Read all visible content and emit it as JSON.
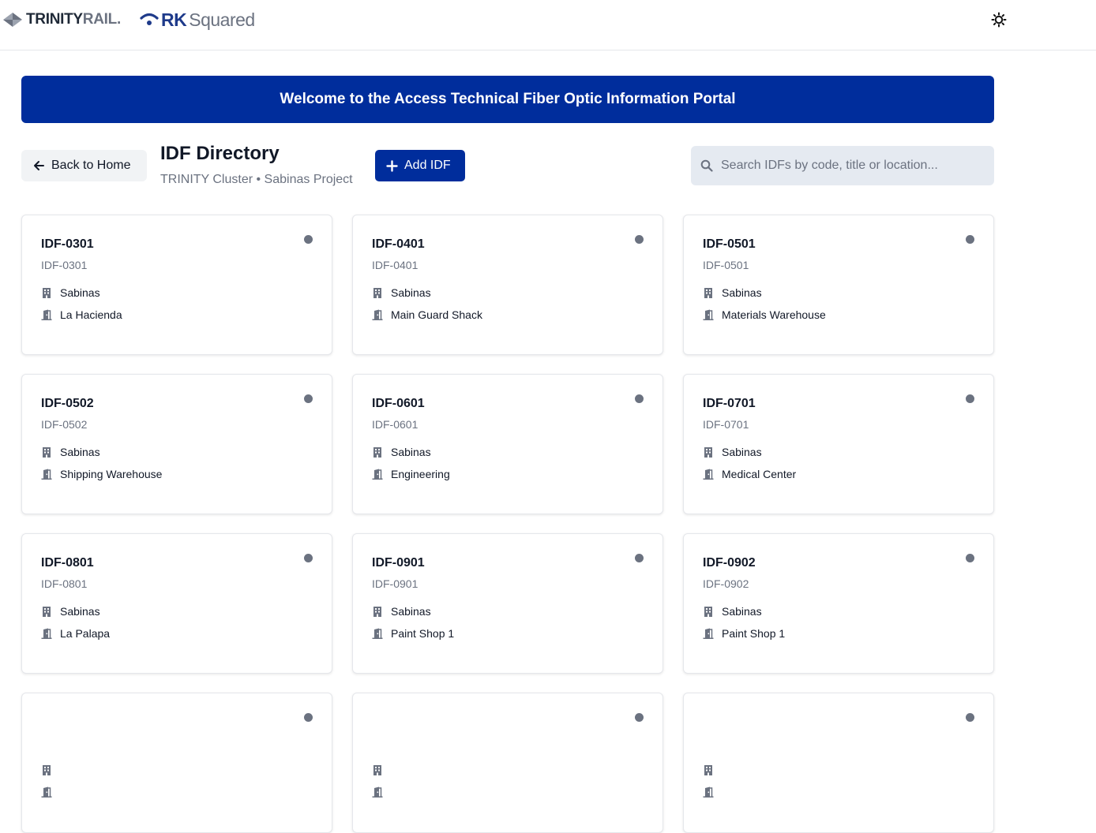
{
  "header": {
    "brand1_main": "TRINITY",
    "brand1_accent": "RAIL",
    "brand1_dot": ".",
    "brand2_main": "RK",
    "brand2_accent": "Squared",
    "theme_icon": "sun-icon"
  },
  "banner": {
    "text": "Welcome to the Access Technical Fiber Optic Information Portal"
  },
  "toolbar": {
    "back_label": "Back to Home",
    "title": "IDF Directory",
    "subtitle": "TRINITY Cluster • Sabinas Project",
    "add_label": "Add IDF",
    "search_placeholder": "Search IDFs by code, title or location..."
  },
  "colors": {
    "primary": "#002d9c",
    "status_dot": "#6b7280"
  },
  "cards": [
    {
      "code": "IDF-0301",
      "subcode": "IDF-0301",
      "site": "Sabinas",
      "location": "La Hacienda"
    },
    {
      "code": "IDF-0401",
      "subcode": "IDF-0401",
      "site": "Sabinas",
      "location": "Main Guard Shack"
    },
    {
      "code": "IDF-0501",
      "subcode": "IDF-0501",
      "site": "Sabinas",
      "location": "Materials Warehouse"
    },
    {
      "code": "IDF-0502",
      "subcode": "IDF-0502",
      "site": "Sabinas",
      "location": "Shipping Warehouse"
    },
    {
      "code": "IDF-0601",
      "subcode": "IDF-0601",
      "site": "Sabinas",
      "location": "Engineering"
    },
    {
      "code": "IDF-0701",
      "subcode": "IDF-0701",
      "site": "Sabinas",
      "location": "Medical Center"
    },
    {
      "code": "IDF-0801",
      "subcode": "IDF-0801",
      "site": "Sabinas",
      "location": "La Palapa"
    },
    {
      "code": "IDF-0901",
      "subcode": "IDF-0901",
      "site": "Sabinas",
      "location": "Paint Shop 1"
    },
    {
      "code": "IDF-0902",
      "subcode": "IDF-0902",
      "site": "Sabinas",
      "location": "Paint Shop 1"
    },
    {
      "code": "",
      "subcode": "",
      "site": "",
      "location": ""
    },
    {
      "code": "",
      "subcode": "",
      "site": "",
      "location": ""
    },
    {
      "code": "",
      "subcode": "",
      "site": "",
      "location": ""
    }
  ]
}
